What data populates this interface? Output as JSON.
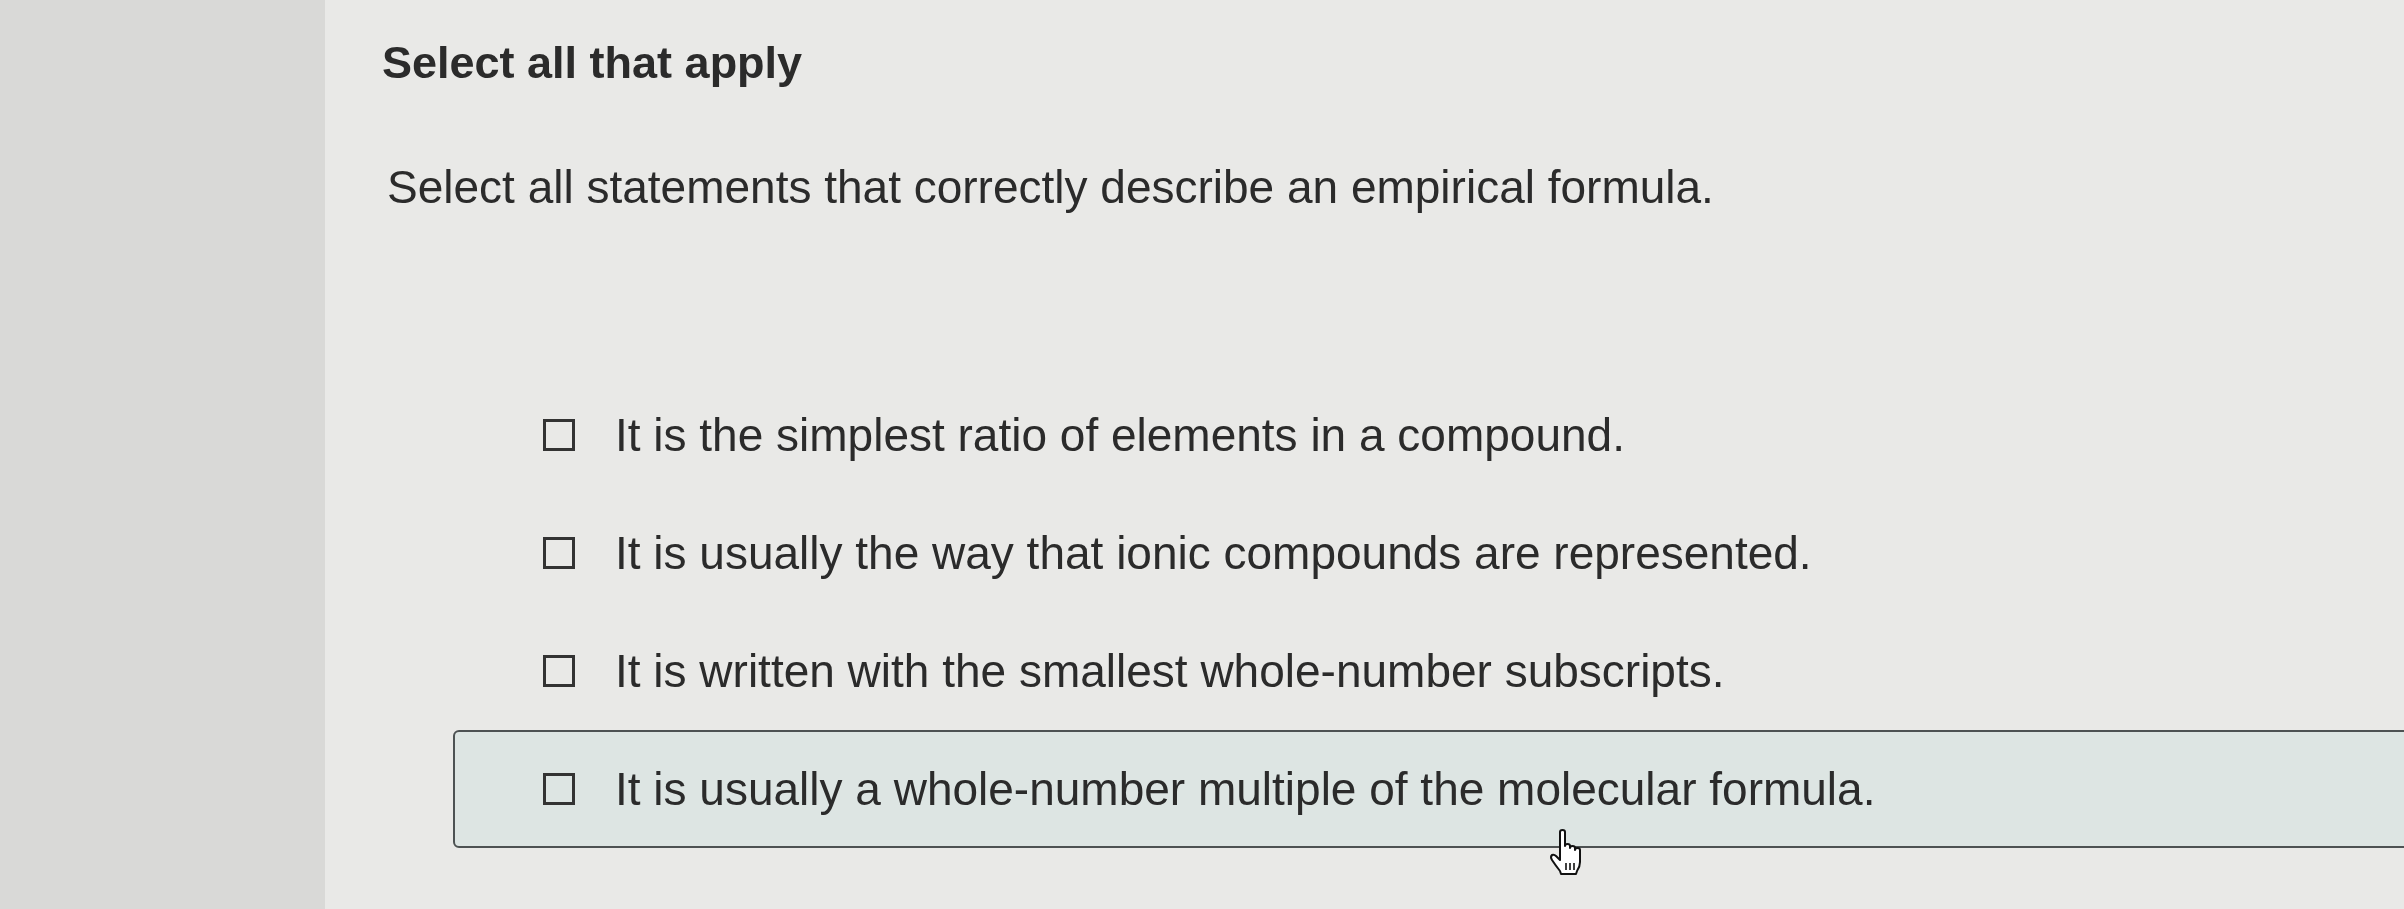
{
  "heading": "Select all that apply",
  "prompt": "Select all statements that correctly describe an empirical formula.",
  "options": [
    {
      "text": "It is the simplest ratio of elements in a compound.",
      "checked": false,
      "hovered": false
    },
    {
      "text": "It is usually the way that ionic compounds are represented.",
      "checked": false,
      "hovered": false
    },
    {
      "text": "It is written with the smallest whole-number subscripts.",
      "checked": false,
      "hovered": false
    },
    {
      "text": "It is usually a whole-number multiple of the molecular formula.",
      "checked": false,
      "hovered": true
    }
  ]
}
